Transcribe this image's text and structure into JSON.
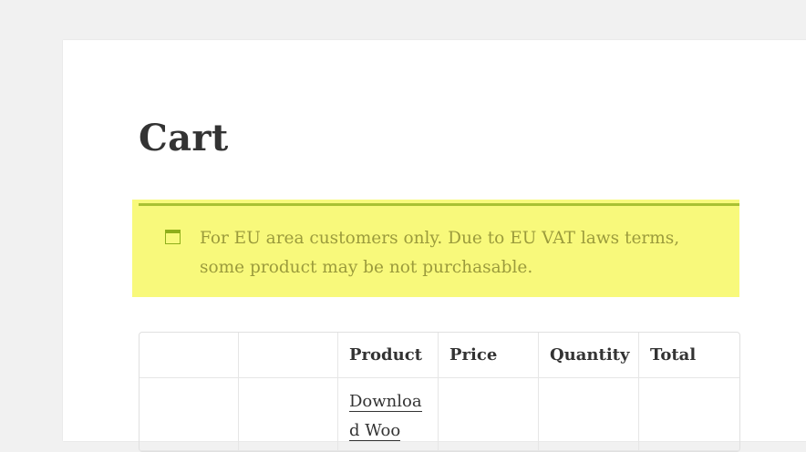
{
  "page": {
    "title": "Cart"
  },
  "notice": {
    "icon": "window-icon",
    "text": "For EU area customers only. Due to EU VAT laws terms, some product may be not purchasable.",
    "colors": {
      "background": "#f8f97b",
      "accent": "#8fae1b",
      "text": "#9b9b3c"
    }
  },
  "cart_table": {
    "headers": [
      "",
      "",
      "Product",
      "Price",
      "Quantity",
      "Total"
    ],
    "rows": [
      {
        "remove": "",
        "thumbnail": "",
        "product": "Download Woo",
        "price": "",
        "quantity": "",
        "total": ""
      }
    ]
  }
}
